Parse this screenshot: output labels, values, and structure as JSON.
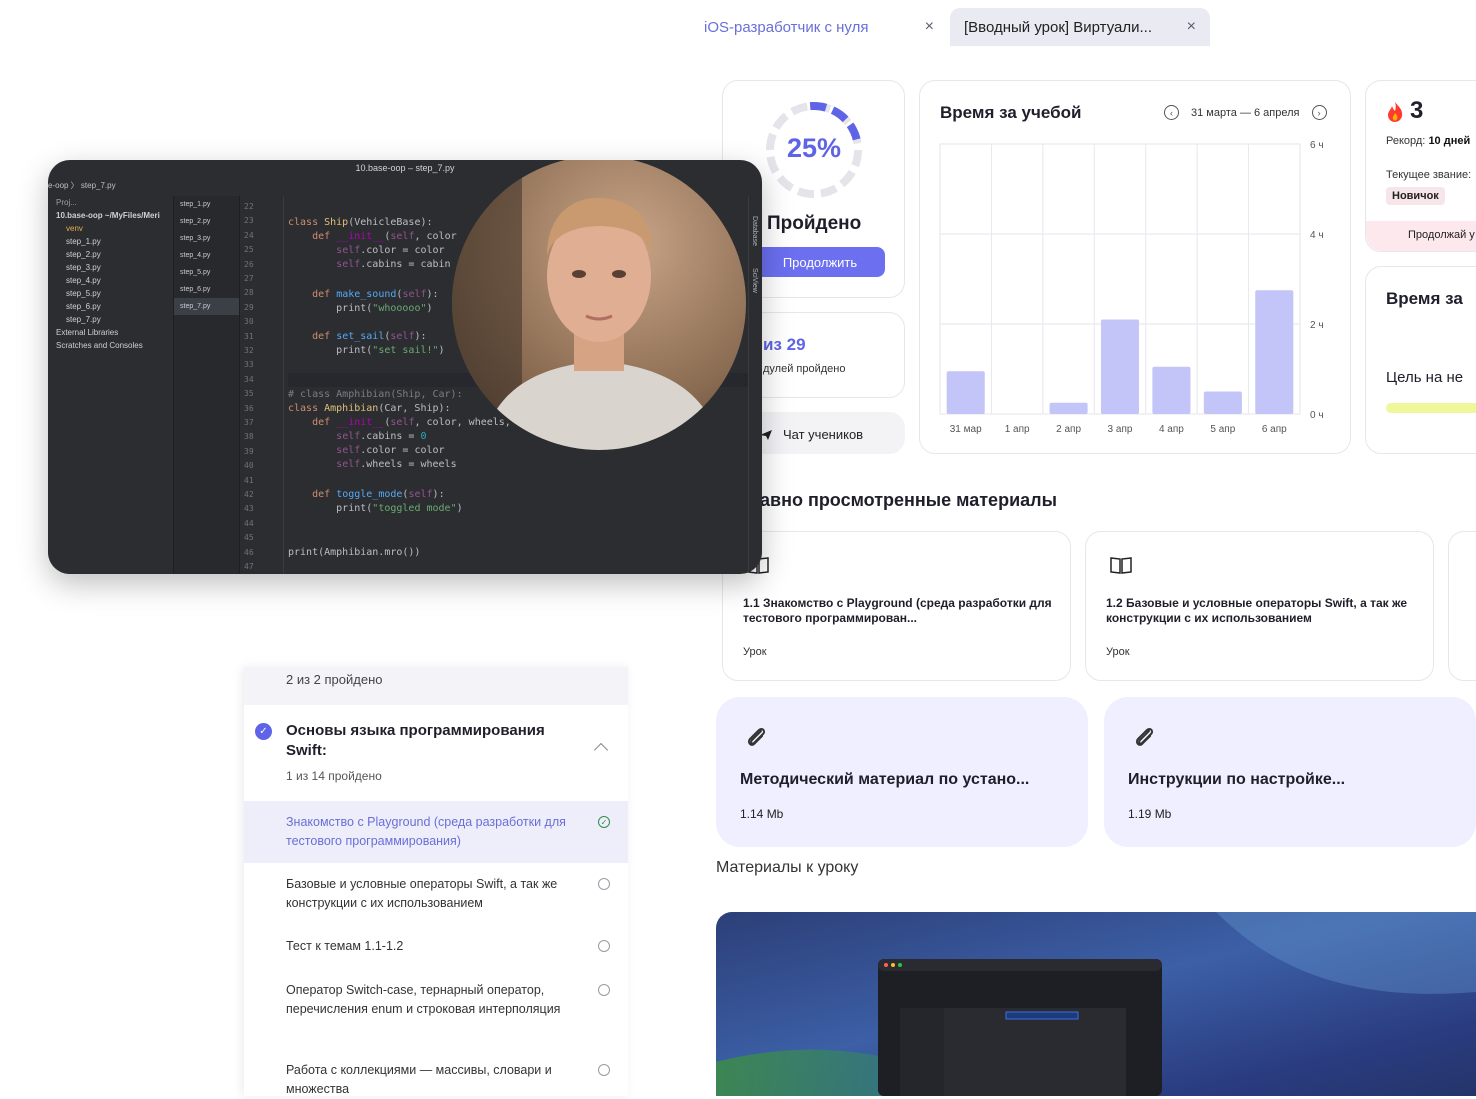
{
  "tabs": [
    {
      "label": "iOS-разработчик с нуля",
      "close": "×"
    },
    {
      "label": "[Вводный урок] Виртуали...",
      "close": "×"
    }
  ],
  "progress": {
    "percent_label": "25%",
    "percent_value": 25,
    "status": "Пройдено",
    "continue_button": "Продолжить"
  },
  "modules": {
    "count_label": "из 29",
    "sub": "дулей пройдено"
  },
  "chat": {
    "label": "Чат учеников"
  },
  "study_time": {
    "title": "Время за учебой",
    "range": "31 марта — 6 апреля",
    "prev_icon": "chevron-left-icon",
    "next_icon": "chevron-right-icon"
  },
  "chart_data": {
    "type": "bar",
    "categories": [
      "31 мар",
      "1 апр",
      "2 апр",
      "3 апр",
      "4 апр",
      "5 апр",
      "6 апр"
    ],
    "values": [
      0.95,
      0,
      0.25,
      2.1,
      1.05,
      0.5,
      2.75
    ],
    "ylabel": "",
    "yticks": [
      "6 ч",
      "4 ч",
      "2 ч",
      "0 ч"
    ],
    "ylim": [
      0,
      6
    ],
    "grid": true,
    "bar_color": "#c3c4f7"
  },
  "streak": {
    "count": "3",
    "record_label": "Рекорд:",
    "record_value": "10 дней",
    "rank_label": "Текущее звание:",
    "rank_value": "Новичок",
    "continue_text": "Продолжай у"
  },
  "time_goal": {
    "title": "Время за",
    "goal": "Цель на не"
  },
  "recent": {
    "title": "авно просмотренные материалы",
    "cards": [
      {
        "title": "1.1 Знакомство с Playground (среда разработки для тестового программирован...",
        "kind": "Урок"
      },
      {
        "title": "1.2 Базовые и условные операторы Swift, а так же конструкции с их использованием",
        "kind": "Урок"
      }
    ]
  },
  "ide": {
    "window_title": "10.base-oop – step_7.py",
    "breadcrumb": "e-oop 〉 step_7.py",
    "project_tree": [
      "Proj...",
      "10.base-oop ~/MyFiles/Meri",
      "venv",
      "step_1.py",
      "step_2.py",
      "step_3.py",
      "step_4.py",
      "step_5.py",
      "step_6.py",
      "step_7.py",
      "External Libraries",
      "Scratches and Consoles"
    ],
    "open_files": [
      "step_1.py",
      "step_2.py",
      "step_3.py",
      "step_4.py",
      "step_5.py",
      "step_6.py",
      "step_7.py"
    ],
    "line_numbers": [
      "22",
      "23",
      "24",
      "25",
      "26",
      "27",
      "28",
      "29",
      "30",
      "31",
      "32",
      "33",
      "34",
      "35",
      "36",
      "37",
      "38",
      "39",
      "40",
      "41",
      "42",
      "43",
      "44",
      "45",
      "46",
      "47"
    ],
    "side_labels": [
      "Database",
      "SciView"
    ]
  },
  "outline": {
    "top_text": "2 из 2 пройдено",
    "section_title": "Основы языка программирования Swift:",
    "section_sub": "1 из 14 пройдено",
    "lessons": [
      {
        "title": "Знакомство с Playground (среда разработки для тестового программирования)",
        "active": true,
        "done": true
      },
      {
        "title": "Базовые и условные операторы Swift, а так же конструкции с их использованием",
        "active": false,
        "done": false
      },
      {
        "title": "Тест к темам 1.1-1.2",
        "active": false,
        "done": false
      },
      {
        "title": "Оператор Switch-case, тернарный оператор, перечисления enum и строковая интерполяция",
        "active": false,
        "done": false
      },
      {
        "title": "Работа с коллекциями — массивы, словари и множества",
        "active": false,
        "done": false
      }
    ]
  },
  "materials": [
    {
      "title": "Методический материал по устано...",
      "size": "1.14 Mb",
      "icon": "paperclip-icon"
    },
    {
      "title": "Инструкции по настройке...",
      "size": "1.19 Mb",
      "icon": "paperclip-icon"
    }
  ],
  "materials_label": "Материалы к уроку"
}
